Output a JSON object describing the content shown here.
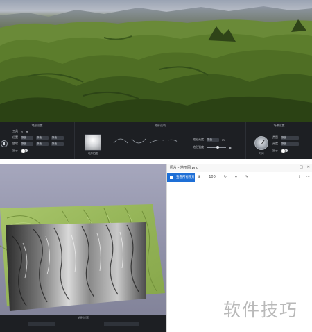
{
  "top_panel": {
    "sections": {
      "material": {
        "title": "地形设置",
        "rows": [
          {
            "label": "工具",
            "fields": []
          },
          {
            "label": "位置",
            "fields": [
              "数值",
              "数值",
              "数值"
            ]
          },
          {
            "label": "旋转",
            "fields": [
              "数值",
              "数值",
              "数值"
            ]
          },
          {
            "label": "显示",
            "fields": []
          }
        ]
      },
      "terrain": {
        "title": "地形选项",
        "preview_label": "地形贴图",
        "params": [
          {
            "label": "地形高度",
            "value": "数值",
            "unit": "m"
          },
          {
            "label": "地形强度",
            "value": "",
            "unit": ""
          }
        ]
      },
      "scene": {
        "title": "场景设置",
        "knob_label": "时间",
        "rows": [
          {
            "label": "类型",
            "value": "数值"
          },
          {
            "label": "亮度",
            "value": "数值"
          },
          {
            "label": "显示",
            "value": ""
          }
        ]
      }
    }
  },
  "bottom_right": {
    "window_title": "照片 - 地形图.png",
    "window_controls": [
      "—",
      "□",
      "✕"
    ],
    "toolbar": {
      "primary_button": "查看所有照片",
      "zoom": "100"
    }
  },
  "bottom_left": {
    "bar_title": "地形设置"
  },
  "watermark": "软件技巧",
  "colors": {
    "toolbar_bg": "#1d1f23",
    "accent_blue": "#1e6fd6",
    "terrain_green": "#5f7c2e",
    "relief_green": "#9bbb5e"
  },
  "icons": [
    "search-icon",
    "zoom-icon",
    "rotate-icon",
    "crop-icon",
    "edit-icon",
    "share-icon",
    "more-icon"
  ]
}
